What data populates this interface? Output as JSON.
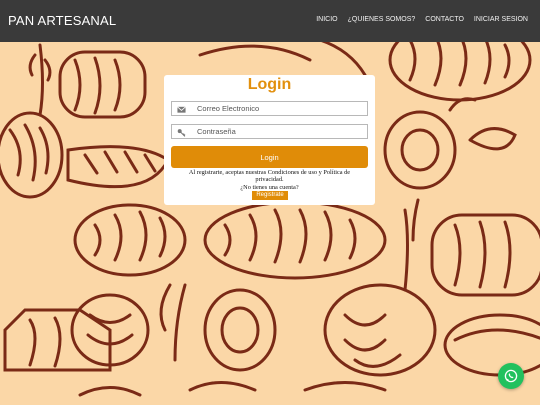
{
  "navbar": {
    "brand": "PAN ARTESANAL",
    "links": [
      "INICIO",
      "¿QUIENES SOMOS?",
      "CONTACTO",
      "INICIAR SESION"
    ]
  },
  "login": {
    "title": "Login",
    "email_placeholder": "Correo Electronico",
    "password_placeholder": "Contraseña",
    "submit_label": "Login",
    "terms_text": "Al registrarte, aceptas nuestras Condiciones de uso y Política de privacidad.",
    "no_account_text": "¿No tienes una cuenta?",
    "register_label": "Registrate"
  },
  "icons": {
    "email": "envelope-icon",
    "password": "key-icon",
    "whatsapp": "whatsapp-icon"
  },
  "colors": {
    "navbar_bg": "#3a3a3a",
    "accent": "#e08c08",
    "background": "#fbd7a7",
    "bread_ink": "#7a2a16",
    "whatsapp": "#22c15e"
  }
}
